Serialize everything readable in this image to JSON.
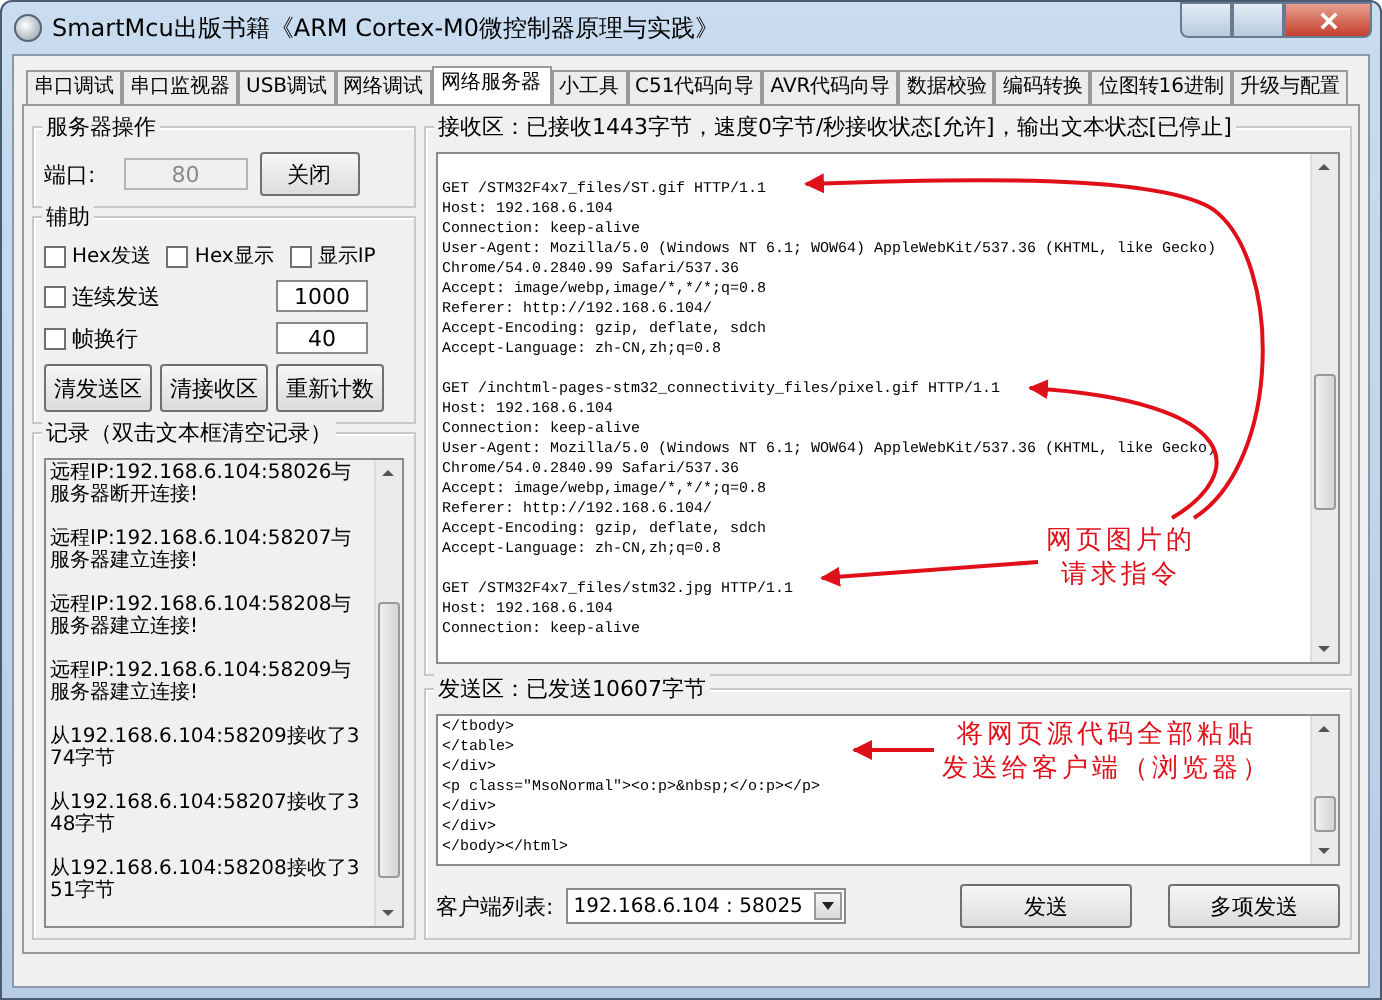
{
  "window": {
    "title": "SmartMcu出版书籍《ARM Cortex-M0微控制器原理与实践》"
  },
  "tabs": [
    {
      "label": "串口调试",
      "selected": false
    },
    {
      "label": "串口监视器",
      "selected": false
    },
    {
      "label": "USB调试",
      "selected": false
    },
    {
      "label": "网络调试",
      "selected": false
    },
    {
      "label": "网络服务器",
      "selected": true
    },
    {
      "label": "小工具",
      "selected": false
    },
    {
      "label": "C51代码向导",
      "selected": false
    },
    {
      "label": "AVR代码向导",
      "selected": false
    },
    {
      "label": "数据校验",
      "selected": false
    },
    {
      "label": "编码转换",
      "selected": false
    },
    {
      "label": "位图转16进制",
      "selected": false
    },
    {
      "label": "升级与配置",
      "selected": false
    }
  ],
  "server": {
    "title": "服务器操作",
    "port_label": "端口:",
    "port_value": "80",
    "port_disabled": true,
    "close_button": "关闭"
  },
  "aux": {
    "title": "辅助",
    "checks": [
      {
        "label": "Hex发送",
        "checked": false
      },
      {
        "label": "Hex显示",
        "checked": false
      },
      {
        "label": "显示IP",
        "checked": false
      }
    ],
    "options": [
      {
        "label": "连续发送",
        "checked": false,
        "value": "1000"
      },
      {
        "label": "帧换行",
        "checked": false,
        "value": "40"
      }
    ],
    "buttons": [
      "清发送区",
      "清接收区",
      "重新计数"
    ]
  },
  "log": {
    "title": "记录（双击文本框清空记录）",
    "entries": [
      "远程IP:192.168.6.104:58026与服务器断开连接!",
      "远程IP:192.168.6.104:58207与服务器建立连接!",
      "远程IP:192.168.6.104:58208与服务器建立连接!",
      "远程IP:192.168.6.104:58209与服务器建立连接!",
      "从192.168.6.104:58209接收了374字节",
      "从192.168.6.104:58207接收了348字节",
      "从192.168.6.104:58208接收了351字节"
    ]
  },
  "receive": {
    "title": "接收区：已接收1443字节，速度0字节/秒接收状态[允许]，输出文本状态[已停止]",
    "blocks": [
      [
        "GET /STM32F4x7_files/ST.gif HTTP/1.1",
        "Host: 192.168.6.104",
        "Connection: keep-alive",
        "User-Agent: Mozilla/5.0 (Windows NT 6.1; WOW64) AppleWebKit/537.36 (KHTML, like Gecko)",
        "Chrome/54.0.2840.99 Safari/537.36",
        "Accept: image/webp,image/*,*/*;q=0.8",
        "Referer: http://192.168.6.104/",
        "Accept-Encoding: gzip, deflate, sdch",
        "Accept-Language: zh-CN,zh;q=0.8"
      ],
      [
        "GET /inchtml-pages-stm32_connectivity_files/pixel.gif HTTP/1.1",
        "Host: 192.168.6.104",
        "Connection: keep-alive",
        "User-Agent: Mozilla/5.0 (Windows NT 6.1; WOW64) AppleWebKit/537.36 (KHTML, like Gecko)",
        "Chrome/54.0.2840.99 Safari/537.36",
        "Accept: image/webp,image/*,*/*;q=0.8",
        "Referer: http://192.168.6.104/",
        "Accept-Encoding: gzip, deflate, sdch",
        "Accept-Language: zh-CN,zh;q=0.8"
      ],
      [
        "GET /STM32F4x7_files/stm32.jpg HTTP/1.1",
        "Host: 192.168.6.104",
        "Connection: keep-alive"
      ]
    ]
  },
  "send": {
    "title": "发送区：已发送10607字节",
    "lines": [
      "</tbody>",
      "</table>",
      "</div>",
      "<p class=\"MsoNormal\"><o:p>&nbsp;</o:p></p>",
      "</div>",
      "</div>",
      "</body></html>"
    ],
    "client_label": "客户端列表:",
    "client_value": "192.168.6.104 : 58025",
    "send_button": "发送",
    "multi_button": "多项发送"
  },
  "annotations": [
    {
      "lines": [
        "网页图片的",
        "请求指令"
      ]
    },
    {
      "lines": [
        "将网页源代码全部粘贴",
        "发送给客户端（浏览器）"
      ]
    }
  ]
}
